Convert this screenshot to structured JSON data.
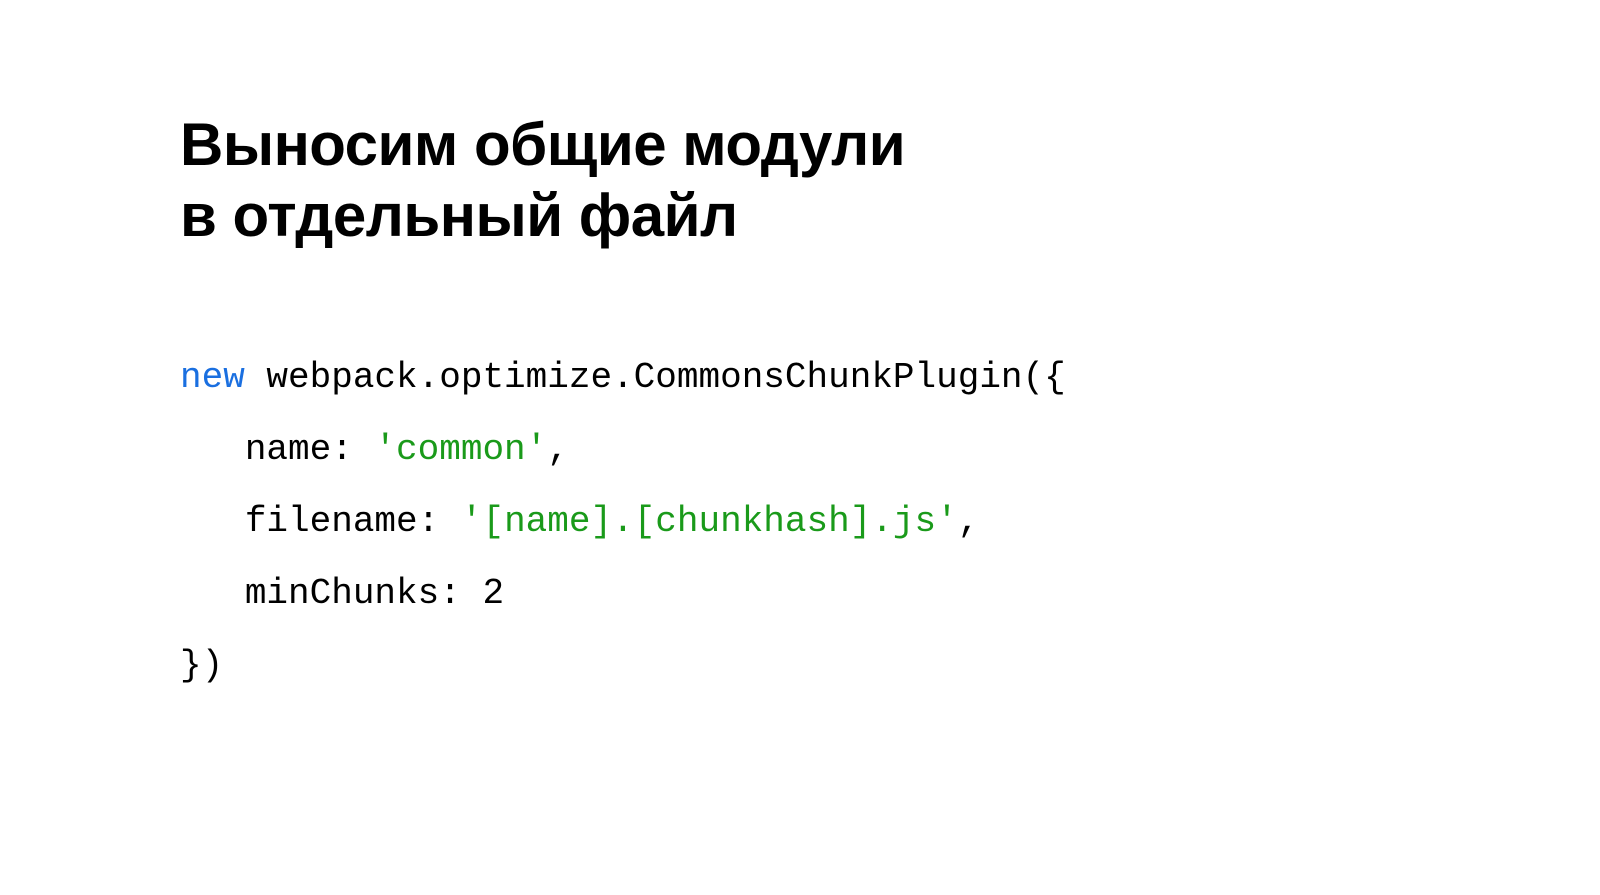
{
  "title_line1": "Выносим общие модули",
  "title_line2": "в отдельный файл",
  "code": {
    "l1": {
      "kw": "new",
      "rest": " webpack.optimize.CommonsChunkPlugin({"
    },
    "l2": {
      "indent": "   ",
      "key": "name: ",
      "str": "'common'",
      "comma": ","
    },
    "l3": {
      "indent": "   ",
      "key": "filename: ",
      "str": "'[name].[chunkhash].js'",
      "comma": ","
    },
    "l4": {
      "indent": "   ",
      "key": "minChunks: 2"
    },
    "l5": "})"
  }
}
